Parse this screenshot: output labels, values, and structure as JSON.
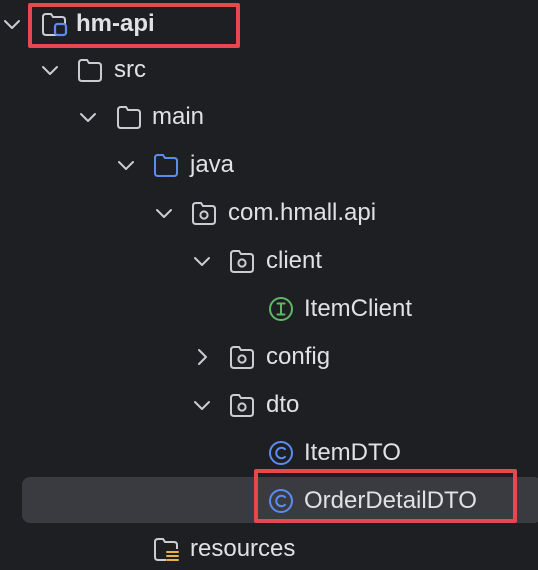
{
  "tree": {
    "items": [
      {
        "label": "hm-api",
        "icon": "module-folder-icon",
        "expanded": true
      },
      {
        "label": "src",
        "icon": "folder-icon",
        "expanded": true
      },
      {
        "label": "main",
        "icon": "folder-icon",
        "expanded": true
      },
      {
        "label": "java",
        "icon": "source-folder-icon",
        "expanded": true
      },
      {
        "label": "com.hmall.api",
        "icon": "package-icon",
        "expanded": true
      },
      {
        "label": "client",
        "icon": "package-icon",
        "expanded": true
      },
      {
        "label": "ItemClient",
        "icon": "interface-icon"
      },
      {
        "label": "config",
        "icon": "package-icon",
        "expanded": false
      },
      {
        "label": "dto",
        "icon": "package-icon",
        "expanded": true
      },
      {
        "label": "ItemDTO",
        "icon": "class-icon"
      },
      {
        "label": "OrderDetailDTO",
        "icon": "class-icon",
        "selected": true
      },
      {
        "label": "resources",
        "icon": "resources-folder-icon"
      }
    ]
  },
  "colors": {
    "background": "#1e1f22",
    "selection": "#393b40",
    "text": "#dfe1e5",
    "folder_outline": "#c9ccd3",
    "source_folder": "#5c8cf0",
    "interface_green": "#5fb865",
    "class_blue": "#5c8cf0",
    "annotation_red": "#e5484d"
  }
}
